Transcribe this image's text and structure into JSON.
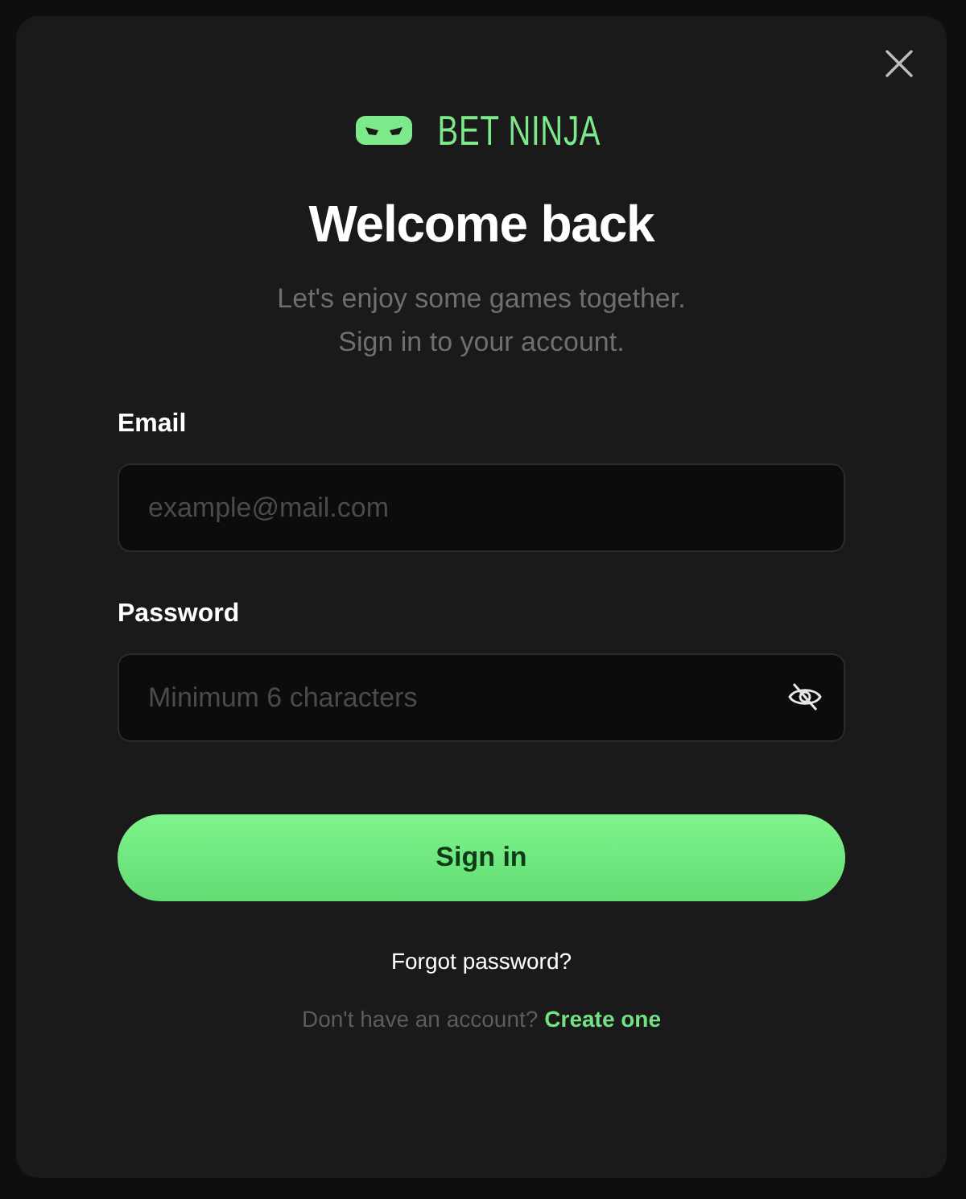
{
  "brand": {
    "name": "BET NINJA"
  },
  "heading": "Welcome back",
  "subtitle": [
    "Let's enjoy some games together.",
    "Sign in to your account."
  ],
  "fields": [
    {
      "kind": "email",
      "label": "Email",
      "placeholder": "example@mail.com"
    },
    {
      "kind": "password",
      "label": "Password",
      "placeholder": "Minimum 6 characters"
    }
  ],
  "primary_button": "Sign in",
  "forgot_link": "Forgot password?",
  "signup": {
    "prompt": "Don't have an account?",
    "link": "Create one"
  }
}
